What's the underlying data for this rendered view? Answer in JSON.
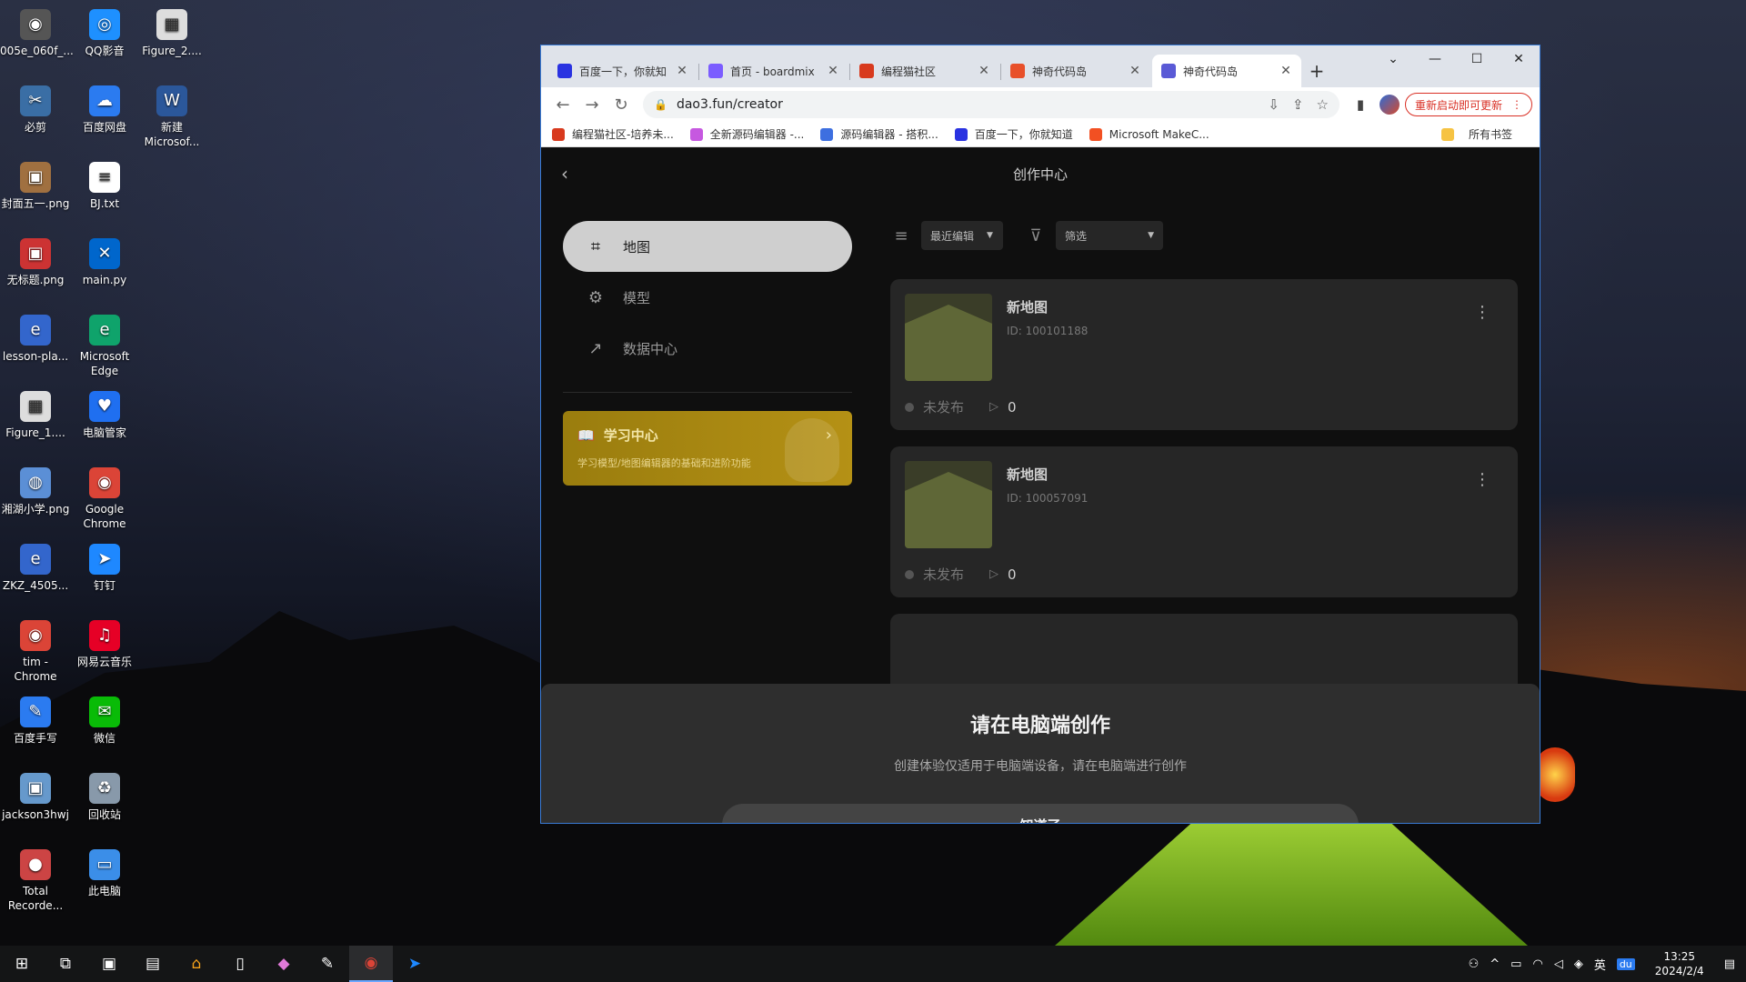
{
  "desktop": {
    "icons": [
      {
        "label": "005e_060f_...",
        "color": "#555555",
        "glyph": "◉"
      },
      {
        "label": "QQ影音",
        "color": "#1e90ff",
        "glyph": "◎"
      },
      {
        "label": "Figure_2....",
        "color": "#eeeeee",
        "glyph": "▦"
      },
      {
        "label": "必剪",
        "color": "#3a6ea5",
        "glyph": "✂"
      },
      {
        "label": "百度网盘",
        "color": "#2b7bf0",
        "glyph": "☁"
      },
      {
        "label": "新建 Microsof...",
        "color": "#2b579a",
        "glyph": "W"
      },
      {
        "label": "封面五一.png",
        "color": "#a07040",
        "glyph": "▣"
      },
      {
        "label": "BJ.txt",
        "color": "#ffffff",
        "glyph": "≡"
      },
      {
        "label": "无标题.png",
        "color": "#cc3333",
        "glyph": "▣"
      },
      {
        "label": "main.py",
        "color": "#0066cc",
        "glyph": "✕"
      },
      {
        "label": "lesson-pla...",
        "color": "#3366cc",
        "glyph": "e"
      },
      {
        "label": "Microsoft Edge",
        "color": "#0fa36b",
        "glyph": "e"
      },
      {
        "label": "Figure_1....",
        "color": "#eeeeee",
        "glyph": "▦"
      },
      {
        "label": "电脑管家",
        "color": "#1f6ff0",
        "glyph": "♥"
      },
      {
        "label": "湘湖小学.png",
        "color": "#5b8fd6",
        "glyph": "◍"
      },
      {
        "label": "Google Chrome",
        "color": "#db4437",
        "glyph": "◉"
      },
      {
        "label": "ZKZ_4505...",
        "color": "#3366cc",
        "glyph": "e"
      },
      {
        "label": "钉钉",
        "color": "#1e88ff",
        "glyph": "➤"
      },
      {
        "label": "tim - Chrome",
        "color": "#db4437",
        "glyph": "◉"
      },
      {
        "label": "网易云音乐",
        "color": "#e60026",
        "glyph": "♫"
      },
      {
        "label": "百度手写",
        "color": "#2b7bf0",
        "glyph": "✎"
      },
      {
        "label": "微信",
        "color": "#09bb07",
        "glyph": "✉"
      },
      {
        "label": "jackson3hwj",
        "color": "#6699cc",
        "glyph": "▣"
      },
      {
        "label": "回收站",
        "color": "#8899aa",
        "glyph": "♻"
      },
      {
        "label": "Total Recorde...",
        "color": "#cc4444",
        "glyph": "●"
      },
      {
        "label": "此电脑",
        "color": "#3b8ee8",
        "glyph": "▭"
      }
    ]
  },
  "browser": {
    "tabs": [
      {
        "label": "百度一下，你就知",
        "color": "#2932e1"
      },
      {
        "label": "首页 - boardmix",
        "color": "#7b5cff"
      },
      {
        "label": "编程猫社区",
        "color": "#d83a1e"
      },
      {
        "label": "神奇代码岛",
        "color": "#e8502a"
      },
      {
        "label": "神奇代码岛",
        "color": "#5a5ad6"
      }
    ],
    "url": "dao3.fun/creator",
    "update_label": "重新启动即可更新",
    "bookmarks": [
      {
        "label": "编程猫社区-培养未...",
        "color": "#d83a1e"
      },
      {
        "label": "全新源码编辑器 -...",
        "color": "#c658e0"
      },
      {
        "label": "源码编辑器 - 搭积...",
        "color": "#3d6fe0"
      },
      {
        "label": "百度一下，你就知道",
        "color": "#2932e1"
      },
      {
        "label": "Microsoft MakeC...",
        "color": "#f25022"
      }
    ],
    "all_bookmarks": "所有书签"
  },
  "page": {
    "title": "创作中心",
    "nav": [
      {
        "label": "地图",
        "icon": "🎮"
      },
      {
        "label": "模型",
        "icon": "⚙"
      },
      {
        "label": "数据中心",
        "icon": "📈"
      }
    ],
    "learn": {
      "title": "学习中心",
      "desc": "学习模型/地图编辑器的基础和进阶功能"
    },
    "sort_label": "最近编辑",
    "filter_label": "筛选",
    "maps": [
      {
        "title": "新地图",
        "id": "ID: 100101188",
        "status": "未发布",
        "plays": "0"
      },
      {
        "title": "新地图",
        "id": "ID: 100057091",
        "status": "未发布",
        "plays": "0"
      }
    ],
    "modal": {
      "title": "请在电脑端创作",
      "desc": "创建体验仅适用于电脑端设备，请在电脑端进行创作",
      "button": "知道了"
    }
  },
  "taskbar": {
    "lang": "英",
    "time": "13:25",
    "date": "2024/2/4"
  }
}
